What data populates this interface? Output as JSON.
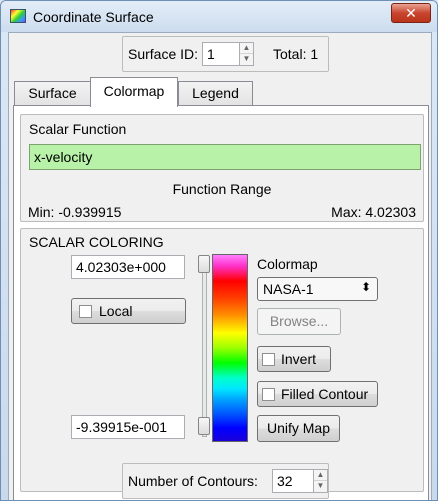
{
  "window": {
    "title": "Coordinate Surface",
    "close_label": "✕"
  },
  "header": {
    "surface_id_label": "Surface ID:",
    "surface_id_value": "1",
    "total_label": "Total: 1"
  },
  "tabs": [
    {
      "label": "Surface",
      "active": false
    },
    {
      "label": "Colormap",
      "active": true
    },
    {
      "label": "Legend",
      "active": false
    }
  ],
  "scalar_function": {
    "group_label": "Scalar Function",
    "function_value": "x-velocity",
    "range_label": "Function Range",
    "min_label": "Min:  -0.939915",
    "max_label": "Max:  4.02303"
  },
  "scalar_coloring": {
    "group_label": "SCALAR COLORING",
    "max_value": "4.02303e+000",
    "min_value": "-9.39915e-001",
    "local_label": "Local",
    "local_checked": false,
    "colormap_label": "Colormap",
    "colormap_selected": "NASA-1",
    "browse_label": "Browse...",
    "invert_label": "Invert",
    "invert_checked": false,
    "filled_contour_label": "Filled Contour",
    "filled_contour_checked": false,
    "unify_map_label": "Unify Map"
  },
  "contours": {
    "label": "Number of Contours:",
    "value": "32"
  },
  "icons": {
    "app": "colormap-icon",
    "spin_up": "▲",
    "spin_down": "▼",
    "dropdown": "⬍"
  }
}
